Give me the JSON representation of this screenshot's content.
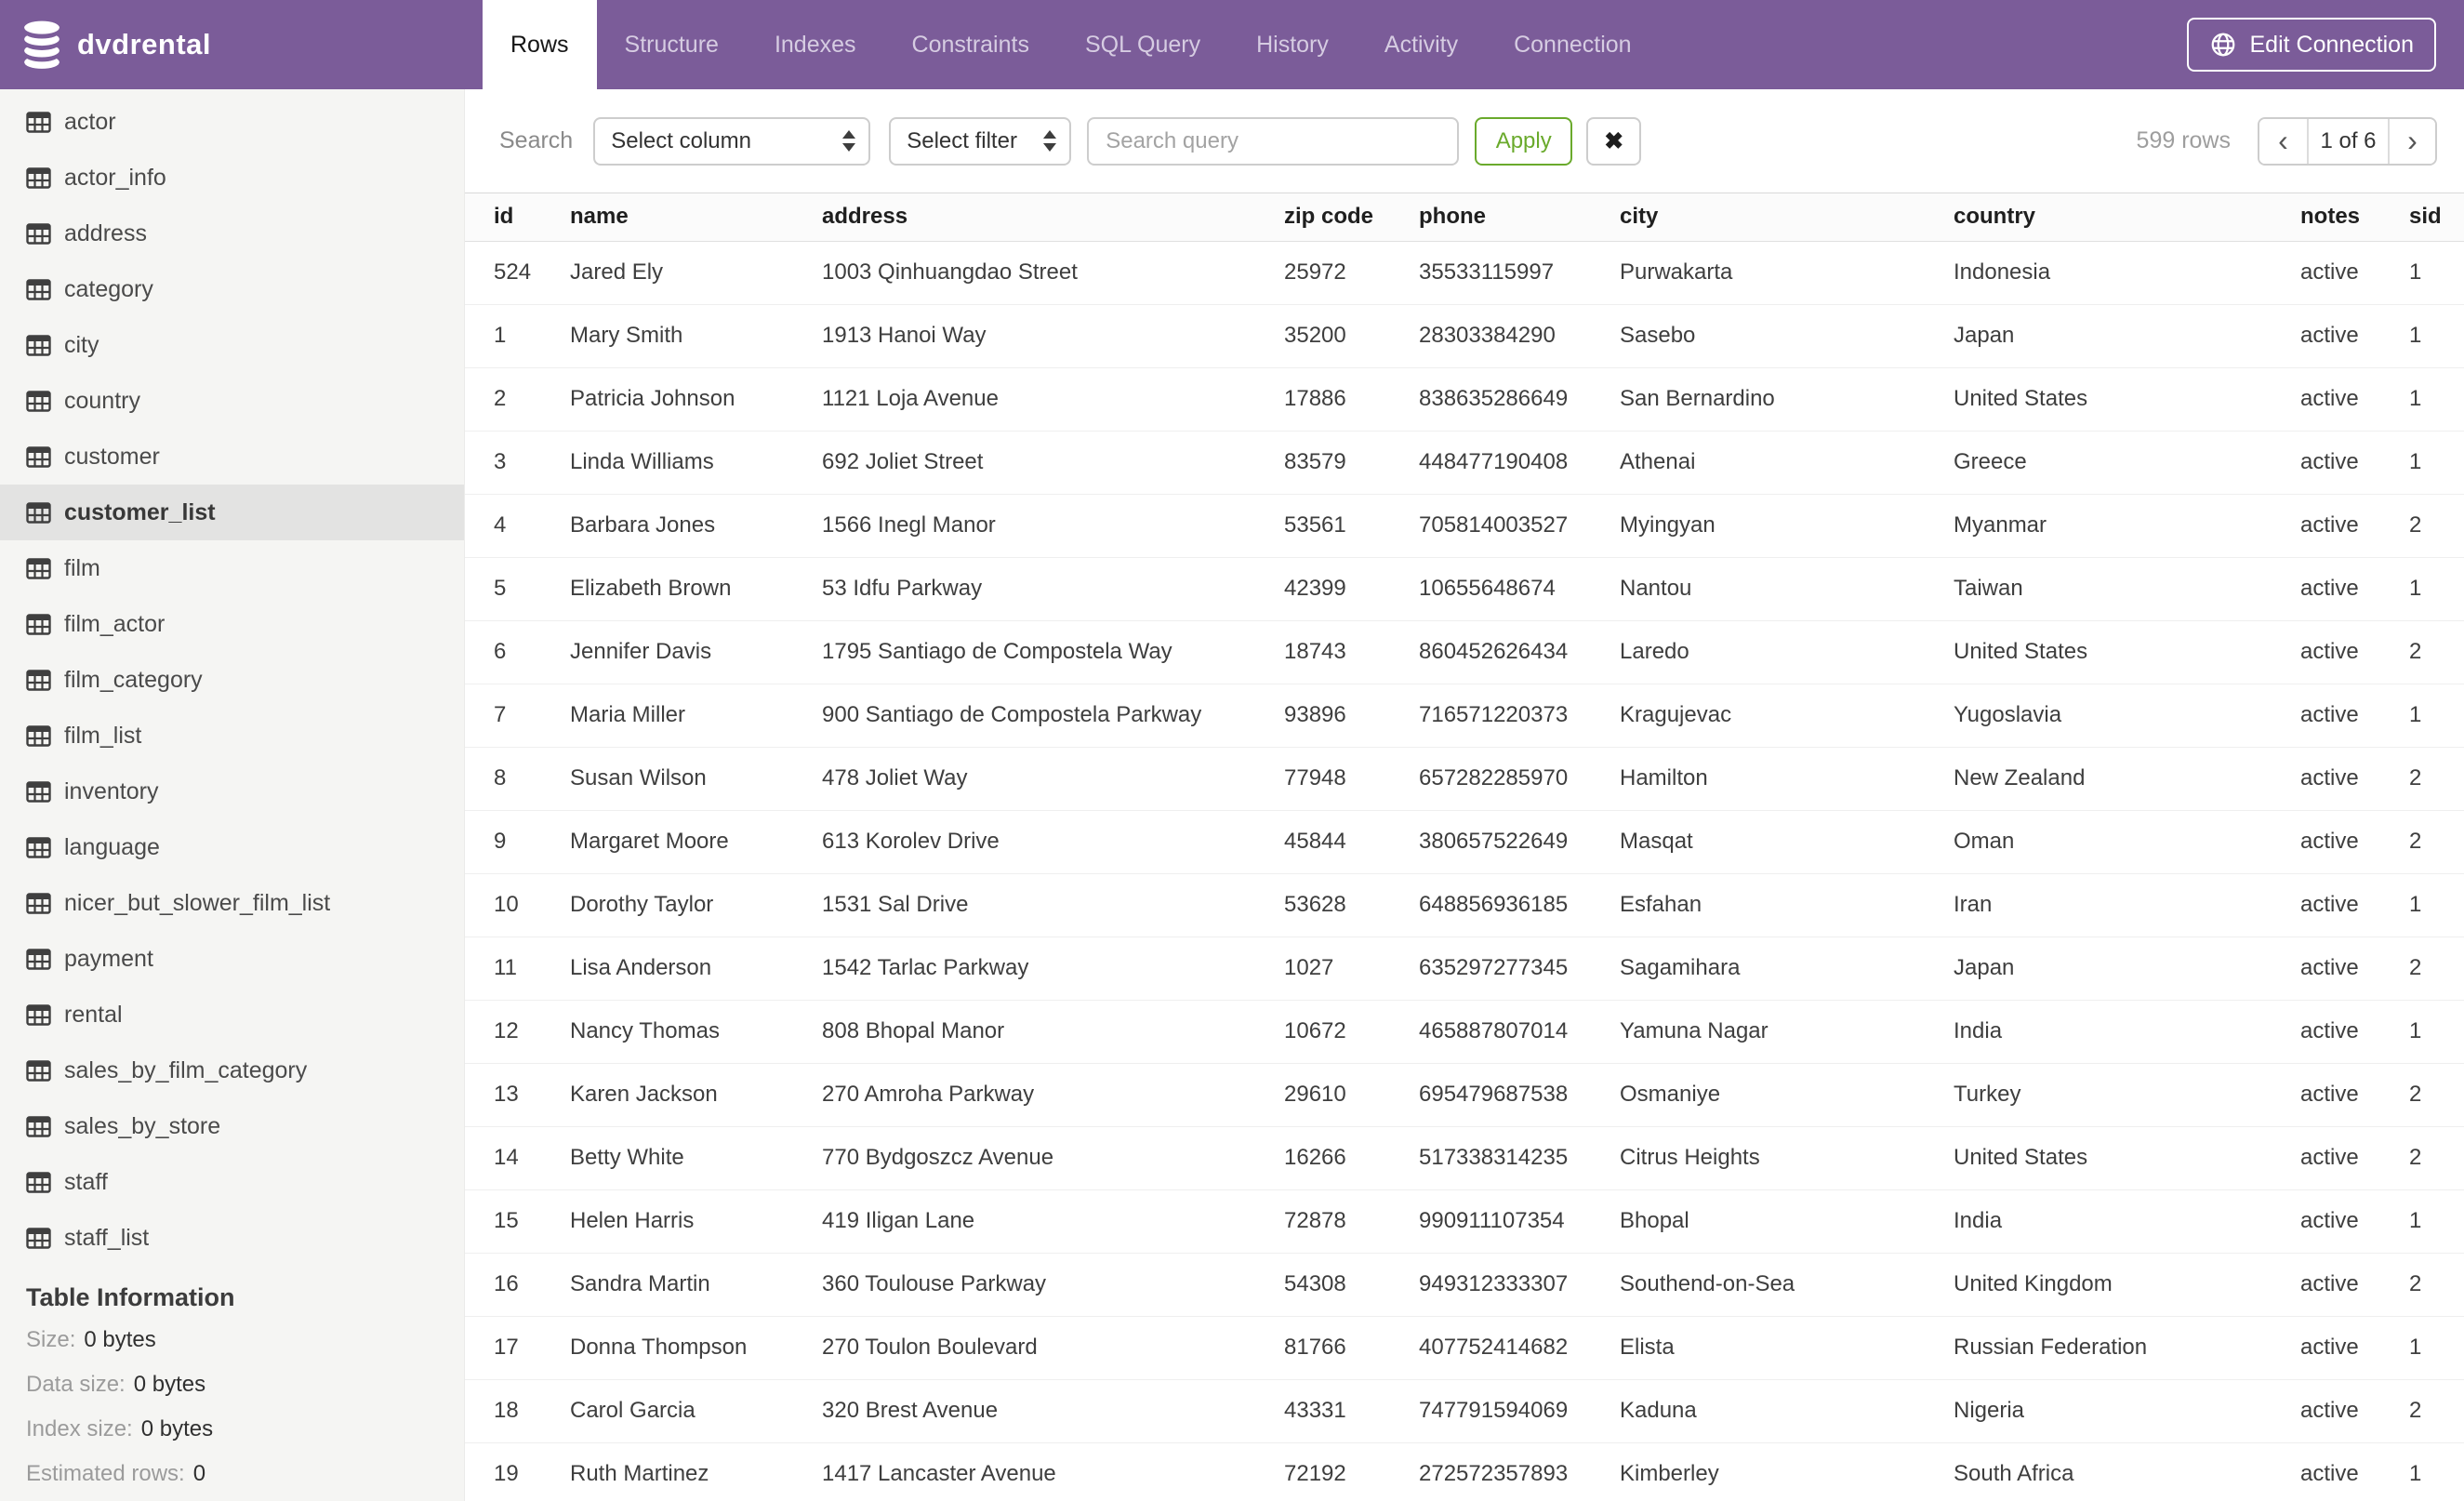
{
  "header": {
    "app_title": "dvdrental",
    "tabs": [
      {
        "label": "Rows",
        "active": true
      },
      {
        "label": "Structure",
        "active": false
      },
      {
        "label": "Indexes",
        "active": false
      },
      {
        "label": "Constraints",
        "active": false
      },
      {
        "label": "SQL Query",
        "active": false
      },
      {
        "label": "History",
        "active": false
      },
      {
        "label": "Activity",
        "active": false
      },
      {
        "label": "Connection",
        "active": false
      }
    ],
    "edit_connection_label": "Edit Connection"
  },
  "icons": {
    "logo": "database-icon",
    "edit_connection": "globe-icon",
    "sidebar_item": "table-grid-icon",
    "select": "updown-arrows-icon",
    "clear": "x-icon",
    "prev": "chevron-left-icon",
    "next": "chevron-right-icon"
  },
  "colors": {
    "header_purple": "#7b5c99",
    "sidebar_bg": "#f5f5f3",
    "selected_item_bg": "#e3e3e2",
    "apply_green": "#6aaa2c"
  },
  "sidebar": {
    "tables": [
      {
        "label": "actor",
        "selected": false
      },
      {
        "label": "actor_info",
        "selected": false
      },
      {
        "label": "address",
        "selected": false
      },
      {
        "label": "category",
        "selected": false
      },
      {
        "label": "city",
        "selected": false
      },
      {
        "label": "country",
        "selected": false
      },
      {
        "label": "customer",
        "selected": false
      },
      {
        "label": "customer_list",
        "selected": true
      },
      {
        "label": "film",
        "selected": false
      },
      {
        "label": "film_actor",
        "selected": false
      },
      {
        "label": "film_category",
        "selected": false
      },
      {
        "label": "film_list",
        "selected": false
      },
      {
        "label": "inventory",
        "selected": false
      },
      {
        "label": "language",
        "selected": false
      },
      {
        "label": "nicer_but_slower_film_list",
        "selected": false
      },
      {
        "label": "payment",
        "selected": false
      },
      {
        "label": "rental",
        "selected": false
      },
      {
        "label": "sales_by_film_category",
        "selected": false
      },
      {
        "label": "sales_by_store",
        "selected": false
      },
      {
        "label": "staff",
        "selected": false
      },
      {
        "label": "staff_list",
        "selected": false
      }
    ],
    "table_information": {
      "heading": "Table Information",
      "rows": [
        {
          "label": "Size:",
          "value": "0 bytes"
        },
        {
          "label": "Data size:",
          "value": "0 bytes"
        },
        {
          "label": "Index size:",
          "value": "0 bytes"
        },
        {
          "label": "Estimated rows:",
          "value": "0"
        }
      ]
    }
  },
  "toolbar": {
    "search_label": "Search",
    "column_select_value": "Select column",
    "filter_select_value": "Select filter",
    "query_placeholder": "Search query",
    "query_value": "",
    "apply_label": "Apply",
    "clear_label": "✖",
    "row_count": "599 rows",
    "pagination": {
      "prev": "‹",
      "current": "1 of 6",
      "next": "›"
    }
  },
  "table": {
    "columns": [
      "id",
      "name",
      "address",
      "zip code",
      "phone",
      "city",
      "country",
      "notes",
      "sid"
    ],
    "rows": [
      {
        "id": "524",
        "name": "Jared Ely",
        "address": "1003 Qinhuangdao Street",
        "zip": "25972",
        "phone": "35533115997",
        "city": "Purwakarta",
        "country": "Indonesia",
        "notes": "active",
        "sid": "1"
      },
      {
        "id": "1",
        "name": "Mary Smith",
        "address": "1913 Hanoi Way",
        "zip": "35200",
        "phone": "28303384290",
        "city": "Sasebo",
        "country": "Japan",
        "notes": "active",
        "sid": "1"
      },
      {
        "id": "2",
        "name": "Patricia Johnson",
        "address": "1121 Loja Avenue",
        "zip": "17886",
        "phone": "838635286649",
        "city": "San Bernardino",
        "country": "United States",
        "notes": "active",
        "sid": "1"
      },
      {
        "id": "3",
        "name": "Linda Williams",
        "address": "692 Joliet Street",
        "zip": "83579",
        "phone": "448477190408",
        "city": "Athenai",
        "country": "Greece",
        "notes": "active",
        "sid": "1"
      },
      {
        "id": "4",
        "name": "Barbara Jones",
        "address": "1566 Inegl Manor",
        "zip": "53561",
        "phone": "705814003527",
        "city": "Myingyan",
        "country": "Myanmar",
        "notes": "active",
        "sid": "2"
      },
      {
        "id": "5",
        "name": "Elizabeth Brown",
        "address": "53 Idfu Parkway",
        "zip": "42399",
        "phone": "10655648674",
        "city": "Nantou",
        "country": "Taiwan",
        "notes": "active",
        "sid": "1"
      },
      {
        "id": "6",
        "name": "Jennifer Davis",
        "address": "1795 Santiago de Compostela Way",
        "zip": "18743",
        "phone": "860452626434",
        "city": "Laredo",
        "country": "United States",
        "notes": "active",
        "sid": "2"
      },
      {
        "id": "7",
        "name": "Maria Miller",
        "address": "900 Santiago de Compostela Parkway",
        "zip": "93896",
        "phone": "716571220373",
        "city": "Kragujevac",
        "country": "Yugoslavia",
        "notes": "active",
        "sid": "1"
      },
      {
        "id": "8",
        "name": "Susan Wilson",
        "address": "478 Joliet Way",
        "zip": "77948",
        "phone": "657282285970",
        "city": "Hamilton",
        "country": "New Zealand",
        "notes": "active",
        "sid": "2"
      },
      {
        "id": "9",
        "name": "Margaret Moore",
        "address": "613 Korolev Drive",
        "zip": "45844",
        "phone": "380657522649",
        "city": "Masqat",
        "country": "Oman",
        "notes": "active",
        "sid": "2"
      },
      {
        "id": "10",
        "name": "Dorothy Taylor",
        "address": "1531 Sal Drive",
        "zip": "53628",
        "phone": "648856936185",
        "city": "Esfahan",
        "country": "Iran",
        "notes": "active",
        "sid": "1"
      },
      {
        "id": "11",
        "name": "Lisa Anderson",
        "address": "1542 Tarlac Parkway",
        "zip": "1027",
        "phone": "635297277345",
        "city": "Sagamihara",
        "country": "Japan",
        "notes": "active",
        "sid": "2"
      },
      {
        "id": "12",
        "name": "Nancy Thomas",
        "address": "808 Bhopal Manor",
        "zip": "10672",
        "phone": "465887807014",
        "city": "Yamuna Nagar",
        "country": "India",
        "notes": "active",
        "sid": "1"
      },
      {
        "id": "13",
        "name": "Karen Jackson",
        "address": "270 Amroha Parkway",
        "zip": "29610",
        "phone": "695479687538",
        "city": "Osmaniye",
        "country": "Turkey",
        "notes": "active",
        "sid": "2"
      },
      {
        "id": "14",
        "name": "Betty White",
        "address": "770 Bydgoszcz Avenue",
        "zip": "16266",
        "phone": "517338314235",
        "city": "Citrus Heights",
        "country": "United States",
        "notes": "active",
        "sid": "2"
      },
      {
        "id": "15",
        "name": "Helen Harris",
        "address": "419 Iligan Lane",
        "zip": "72878",
        "phone": "990911107354",
        "city": "Bhopal",
        "country": "India",
        "notes": "active",
        "sid": "1"
      },
      {
        "id": "16",
        "name": "Sandra Martin",
        "address": "360 Toulouse Parkway",
        "zip": "54308",
        "phone": "949312333307",
        "city": "Southend-on-Sea",
        "country": "United Kingdom",
        "notes": "active",
        "sid": "2"
      },
      {
        "id": "17",
        "name": "Donna Thompson",
        "address": "270 Toulon Boulevard",
        "zip": "81766",
        "phone": "407752414682",
        "city": "Elista",
        "country": "Russian Federation",
        "notes": "active",
        "sid": "1"
      },
      {
        "id": "18",
        "name": "Carol Garcia",
        "address": "320 Brest Avenue",
        "zip": "43331",
        "phone": "747791594069",
        "city": "Kaduna",
        "country": "Nigeria",
        "notes": "active",
        "sid": "2"
      },
      {
        "id": "19",
        "name": "Ruth Martinez",
        "address": "1417 Lancaster Avenue",
        "zip": "72192",
        "phone": "272572357893",
        "city": "Kimberley",
        "country": "South Africa",
        "notes": "active",
        "sid": "1"
      }
    ]
  }
}
